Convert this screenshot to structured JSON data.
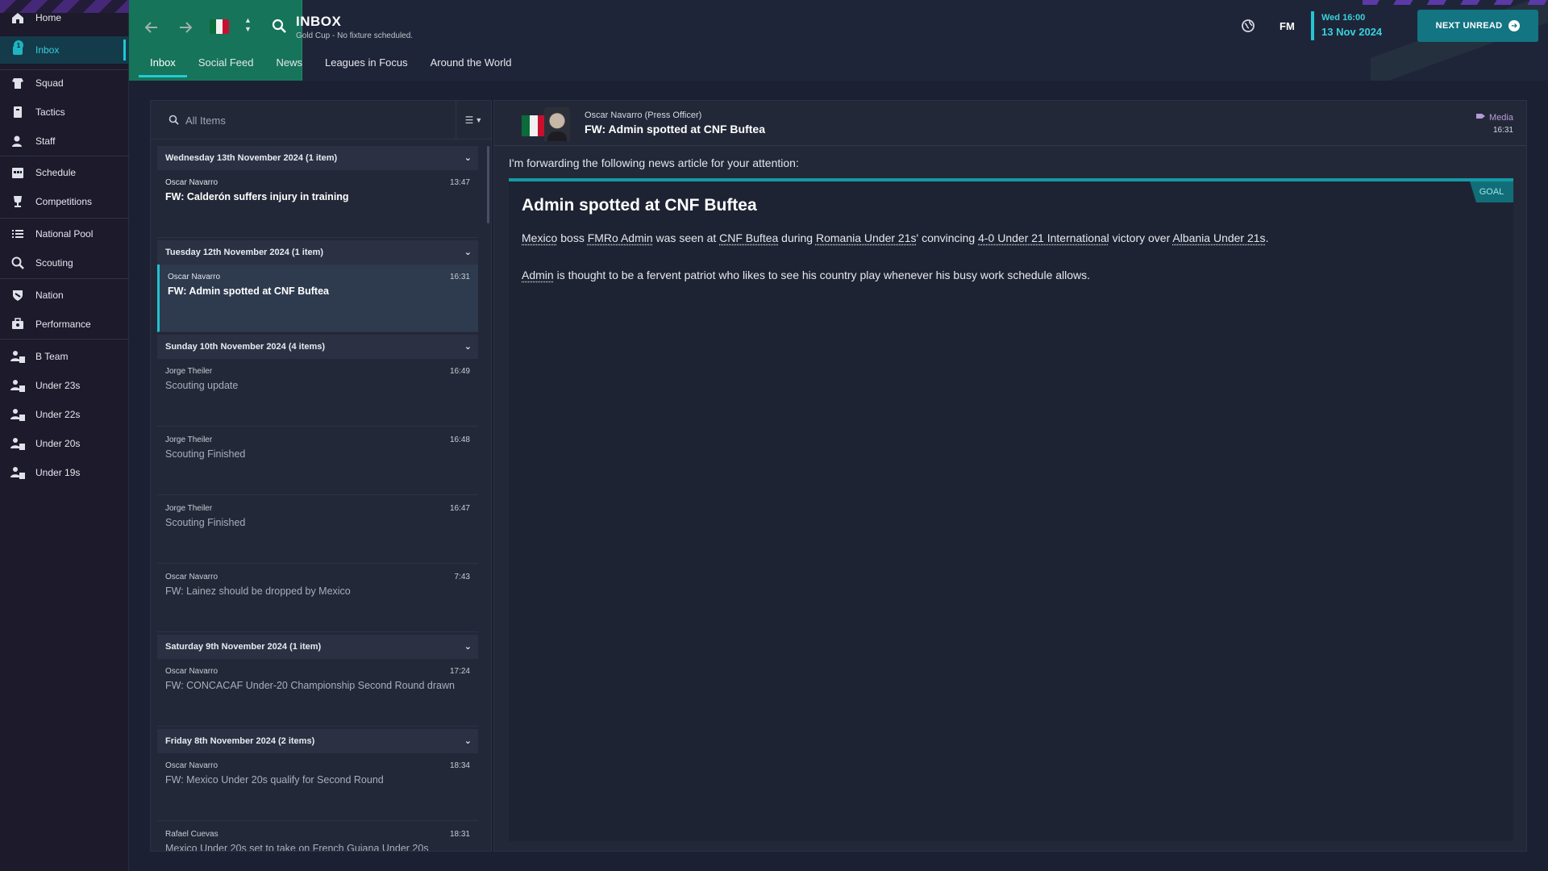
{
  "sidebar": {
    "inbox_badge": "1",
    "items": [
      {
        "label": "Home",
        "icon": "home-icon"
      },
      {
        "label": "Inbox",
        "icon": "inbox-icon"
      },
      {
        "label": "Squad",
        "icon": "squad-icon"
      },
      {
        "label": "Tactics",
        "icon": "tactics-icon"
      },
      {
        "label": "Staff",
        "icon": "staff-icon"
      },
      {
        "label": "Schedule",
        "icon": "calendar-icon"
      },
      {
        "label": "Competitions",
        "icon": "trophy-icon"
      },
      {
        "label": "National Pool",
        "icon": "list-icon"
      },
      {
        "label": "Scouting",
        "icon": "search-icon"
      },
      {
        "label": "Nation",
        "icon": "shield-icon"
      },
      {
        "label": "Performance",
        "icon": "performance-icon"
      },
      {
        "label": "B Team",
        "icon": "team-icon"
      },
      {
        "label": "Under 23s",
        "icon": "team-icon"
      },
      {
        "label": "Under 22s",
        "icon": "team-icon"
      },
      {
        "label": "Under 20s",
        "icon": "team-icon"
      },
      {
        "label": "Under 19s",
        "icon": "team-icon"
      }
    ]
  },
  "header": {
    "title": "INBOX",
    "subtitle": "Gold Cup - No fixture scheduled.",
    "tabs": [
      "Inbox",
      "Social Feed",
      "News",
      "Leagues in Focus",
      "Around the World"
    ],
    "logo": "FM",
    "date_line1": "Wed 16:00",
    "date_line2": "13 Nov 2024",
    "next_button": "NEXT UNREAD"
  },
  "list": {
    "search_placeholder": "All Items",
    "groups": [
      {
        "label": "Wednesday 13th November 2024 (1 item)"
      },
      {
        "label": "Tuesday 12th November 2024 (1 item)"
      },
      {
        "label": "Sunday 10th November 2024 (4 items)"
      },
      {
        "label": "Saturday 9th November 2024 (1 item)"
      },
      {
        "label": "Friday 8th November 2024 (2 items)"
      }
    ],
    "messages": [
      {
        "sender": "Oscar Navarro",
        "time": "13:47",
        "subject": "FW: Calderón suffers injury in training"
      },
      {
        "sender": "Oscar Navarro",
        "time": "16:31",
        "subject": "FW: Admin spotted at CNF Buftea"
      },
      {
        "sender": "Jorge Theiler",
        "time": "16:49",
        "subject": "Scouting update"
      },
      {
        "sender": "Jorge Theiler",
        "time": "16:48",
        "subject": "Scouting Finished"
      },
      {
        "sender": "Jorge Theiler",
        "time": "16:47",
        "subject": "Scouting Finished"
      },
      {
        "sender": "Oscar Navarro",
        "time": "7:43",
        "subject": "FW: Lainez should be dropped by Mexico"
      },
      {
        "sender": "Oscar Navarro",
        "time": "17:24",
        "subject": "FW: CONCACAF Under-20 Championship Second Round drawn"
      },
      {
        "sender": "Oscar Navarro",
        "time": "18:34",
        "subject": "FW: Mexico Under 20s qualify for Second Round"
      },
      {
        "sender": "Rafael Cuevas",
        "time": "18:31",
        "subject": "Mexico Under 20s set to take on French Guiana Under 20s"
      }
    ]
  },
  "detail": {
    "from": "Oscar Navarro  (Press Officer)",
    "subject": "FW: Admin spotted at CNF Buftea",
    "category": "Media",
    "time": "16:31",
    "intro": "I'm forwarding the following news article for your attention:",
    "tag": "GOAL",
    "article_title": "Admin spotted at CNF Buftea",
    "p1": {
      "a": "Mexico",
      "b": " boss ",
      "c": "FMRo Admin",
      "d": " was seen at ",
      "e": "CNF Buftea",
      "f": " during ",
      "g": "Romania Under 21s",
      "h": "' convincing ",
      "i": "4-0 Under 21 International",
      "j": " victory over ",
      "k": "Albania Under 21s",
      "l": "."
    },
    "p2": {
      "a": "Admin",
      "b": " is thought to be a fervent patriot who likes to see his country play whenever his busy work schedule allows."
    }
  },
  "colors": {
    "accent": "#1fc7d4",
    "header_green": "#16745a",
    "button": "#137482"
  }
}
